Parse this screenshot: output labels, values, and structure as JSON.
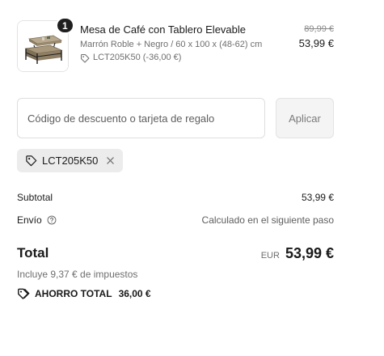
{
  "product": {
    "quantity": "1",
    "name": "Mesa de Café con Tablero Elevable",
    "variant": "Marrón Roble + Negro / 60 x 100 x (48-62) cm",
    "discount_line": "LCT205K50 (-36,00 €)",
    "original_price": "89,99 €",
    "price": "53,99 €",
    "thumbnail_icon": "coffee-table-image"
  },
  "discount": {
    "placeholder": "Código de descuento o tarjeta de regalo",
    "value": "",
    "apply_label": "Aplicar",
    "applied_code": "LCT205K50"
  },
  "summary": {
    "subtotal_label": "Subtotal",
    "subtotal_value": "53,99 €",
    "shipping_label": "Envío",
    "shipping_value": "Calculado en el siguiente paso",
    "total_label": "Total",
    "currency": "EUR",
    "total_value": "53,99 €",
    "taxes_note": "Incluye 9,37 € de impuestos",
    "savings_label": "AHORRO TOTAL",
    "savings_value": "36,00 €"
  },
  "colors": {
    "text": "#1a1a1a",
    "muted": "#6f6f6f",
    "border": "#dedede",
    "chip_bg": "#ececec",
    "badge_bg": "#1f1f1f"
  }
}
